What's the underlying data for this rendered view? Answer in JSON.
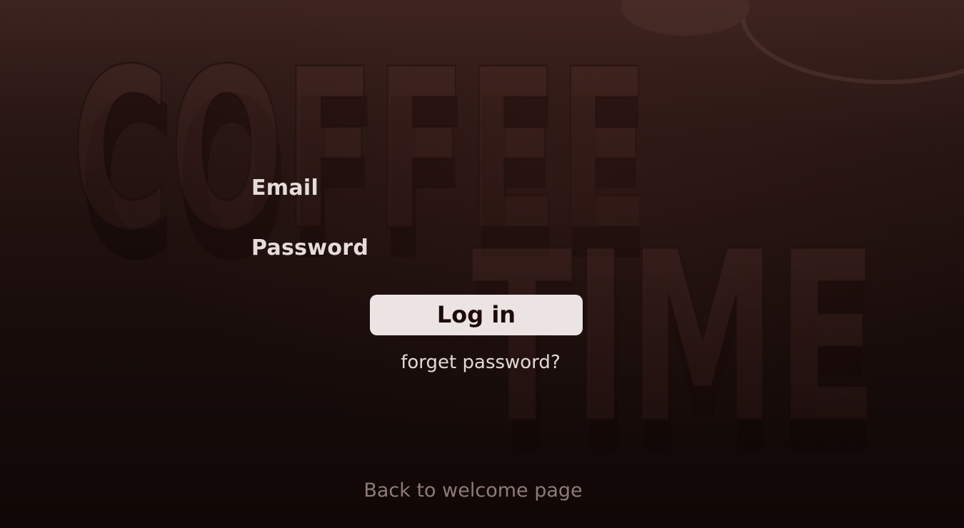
{
  "background": {
    "logo_text_line1": "COFFEE",
    "logo_text_line2": "TIME"
  },
  "form": {
    "email_label": "Email",
    "email_value": "",
    "password_label": "Password",
    "password_value": "",
    "login_label": "Log in",
    "forgot_label": "forget password?"
  },
  "footer": {
    "back_label": "Back to welcome page"
  },
  "colors": {
    "background_top": "#3d2420",
    "background_bottom": "#150908",
    "button_bg": "#ece4e3",
    "button_text": "#1d0c0b",
    "label_text": "#e6dcdb",
    "muted_link": "#8e7b79"
  }
}
